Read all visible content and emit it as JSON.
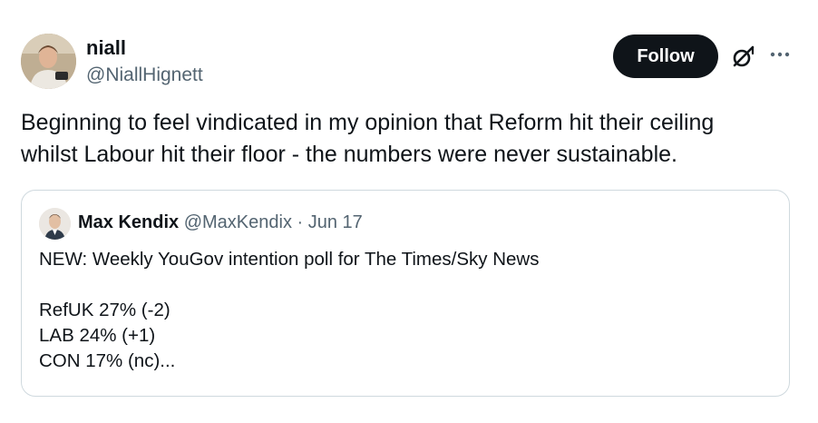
{
  "tweet": {
    "author": {
      "name": "niall",
      "handle": "@NiallHignett"
    },
    "follow_label": "Follow",
    "text_lines": [
      "Beginning to feel vindicated in my opinion that Reform hit their ceiling",
      "whilst Labour hit their floor - the numbers were never sustainable."
    ]
  },
  "quote": {
    "author": {
      "name": "Max Kendix",
      "handle": "@MaxKendix",
      "date": "· Jun 17"
    },
    "lines": [
      "NEW: Weekly YouGov intention poll for The Times/Sky News",
      "",
      "RefUK 27% (-2)",
      "LAB 24% (+1)",
      "CON 17% (nc)..."
    ]
  },
  "icons": {
    "grok": "grok-icon",
    "more": "more-dots-icon"
  },
  "colors": {
    "text_primary": "#0f1419",
    "text_secondary": "#536471",
    "follow_bg": "#0f1419",
    "border": "#cfd9de"
  }
}
